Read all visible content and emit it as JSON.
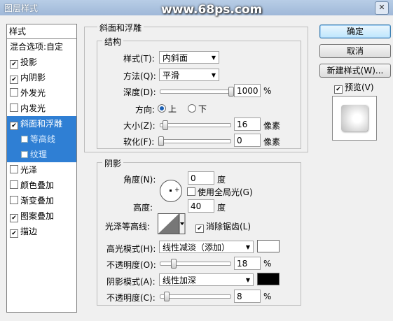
{
  "window": {
    "title": "图层样式",
    "close": "✕"
  },
  "watermark": "www.68ps.com",
  "left": {
    "header": "样式",
    "blend": "混合选项:自定",
    "items": [
      {
        "label": "投影",
        "checked": true
      },
      {
        "label": "内阴影",
        "checked": true
      },
      {
        "label": "外发光",
        "checked": false
      },
      {
        "label": "内发光",
        "checked": false
      },
      {
        "label": "斜面和浮雕",
        "checked": true
      },
      {
        "label": "等高线",
        "checked": false
      },
      {
        "label": "纹理",
        "checked": false
      },
      {
        "label": "光泽",
        "checked": false
      },
      {
        "label": "颜色叠加",
        "checked": false
      },
      {
        "label": "渐变叠加",
        "checked": false
      },
      {
        "label": "图案叠加",
        "checked": true
      },
      {
        "label": "描边",
        "checked": true
      }
    ]
  },
  "bevel": {
    "group_title": "斜面和浮雕",
    "structure_title": "结构",
    "style_label": "样式(T):",
    "style_value": "内斜面",
    "method_label": "方法(Q):",
    "method_value": "平滑",
    "depth_label": "深度(D):",
    "depth_value": "1000",
    "depth_unit": "%",
    "depth_frac": 1.0,
    "direction_label": "方向:",
    "dir_up": "上",
    "dir_down": "下",
    "size_label": "大小(Z):",
    "size_value": "16",
    "size_unit": "像素",
    "size_frac": 0.06,
    "soften_label": "软化(F):",
    "soften_value": "0",
    "soften_unit": "像素",
    "soften_frac": 0.0
  },
  "shading": {
    "title": "阴影",
    "angle_label": "角度(N):",
    "angle_value": "0",
    "angle_unit": "度",
    "global_light": "使用全局光(G)",
    "global_light_checked": false,
    "altitude_label": "高度:",
    "altitude_value": "40",
    "altitude_unit": "度",
    "gloss_label": "光泽等高线:",
    "antialias": "消除锯齿(L)",
    "antialias_checked": true,
    "highlight_label": "高光模式(H):",
    "highlight_mode": "线性减淡（添加）",
    "highlight_color": "#ffffff",
    "hl_opacity_label": "不透明度(O):",
    "hl_opacity_value": "18",
    "hl_opacity_unit": "%",
    "hl_opacity_frac": 0.18,
    "shadow_label": "阴影模式(A):",
    "shadow_mode": "线性加深",
    "shadow_color": "#000000",
    "sh_opacity_label": "不透明度(C):",
    "sh_opacity_value": "8",
    "sh_opacity_unit": "%",
    "sh_opacity_frac": 0.08
  },
  "buttons": {
    "ok": "确定",
    "cancel": "取消",
    "new_style": "新建样式(W)...",
    "preview": "预览(V)",
    "preview_checked": true
  }
}
